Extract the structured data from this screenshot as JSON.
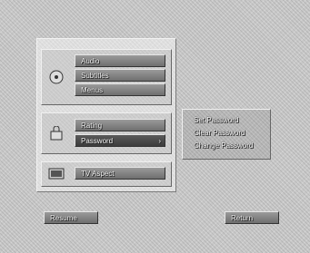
{
  "menu": {
    "group1": {
      "icon": "audio-dvd-icon",
      "items": [
        "Audio",
        "Subtitles",
        "Menus"
      ]
    },
    "group2": {
      "icon": "lock-icon",
      "items": [
        "Rating",
        "Password"
      ],
      "selected": "Password",
      "submenu_arrow": "›"
    },
    "group3": {
      "icon": "tv-icon",
      "items": [
        "TV Aspect"
      ]
    }
  },
  "submenu": {
    "items": [
      "Set Password",
      "Clear Password",
      "Change Password"
    ]
  },
  "footer": {
    "resume_label": "Resume",
    "return_label": "Return"
  }
}
